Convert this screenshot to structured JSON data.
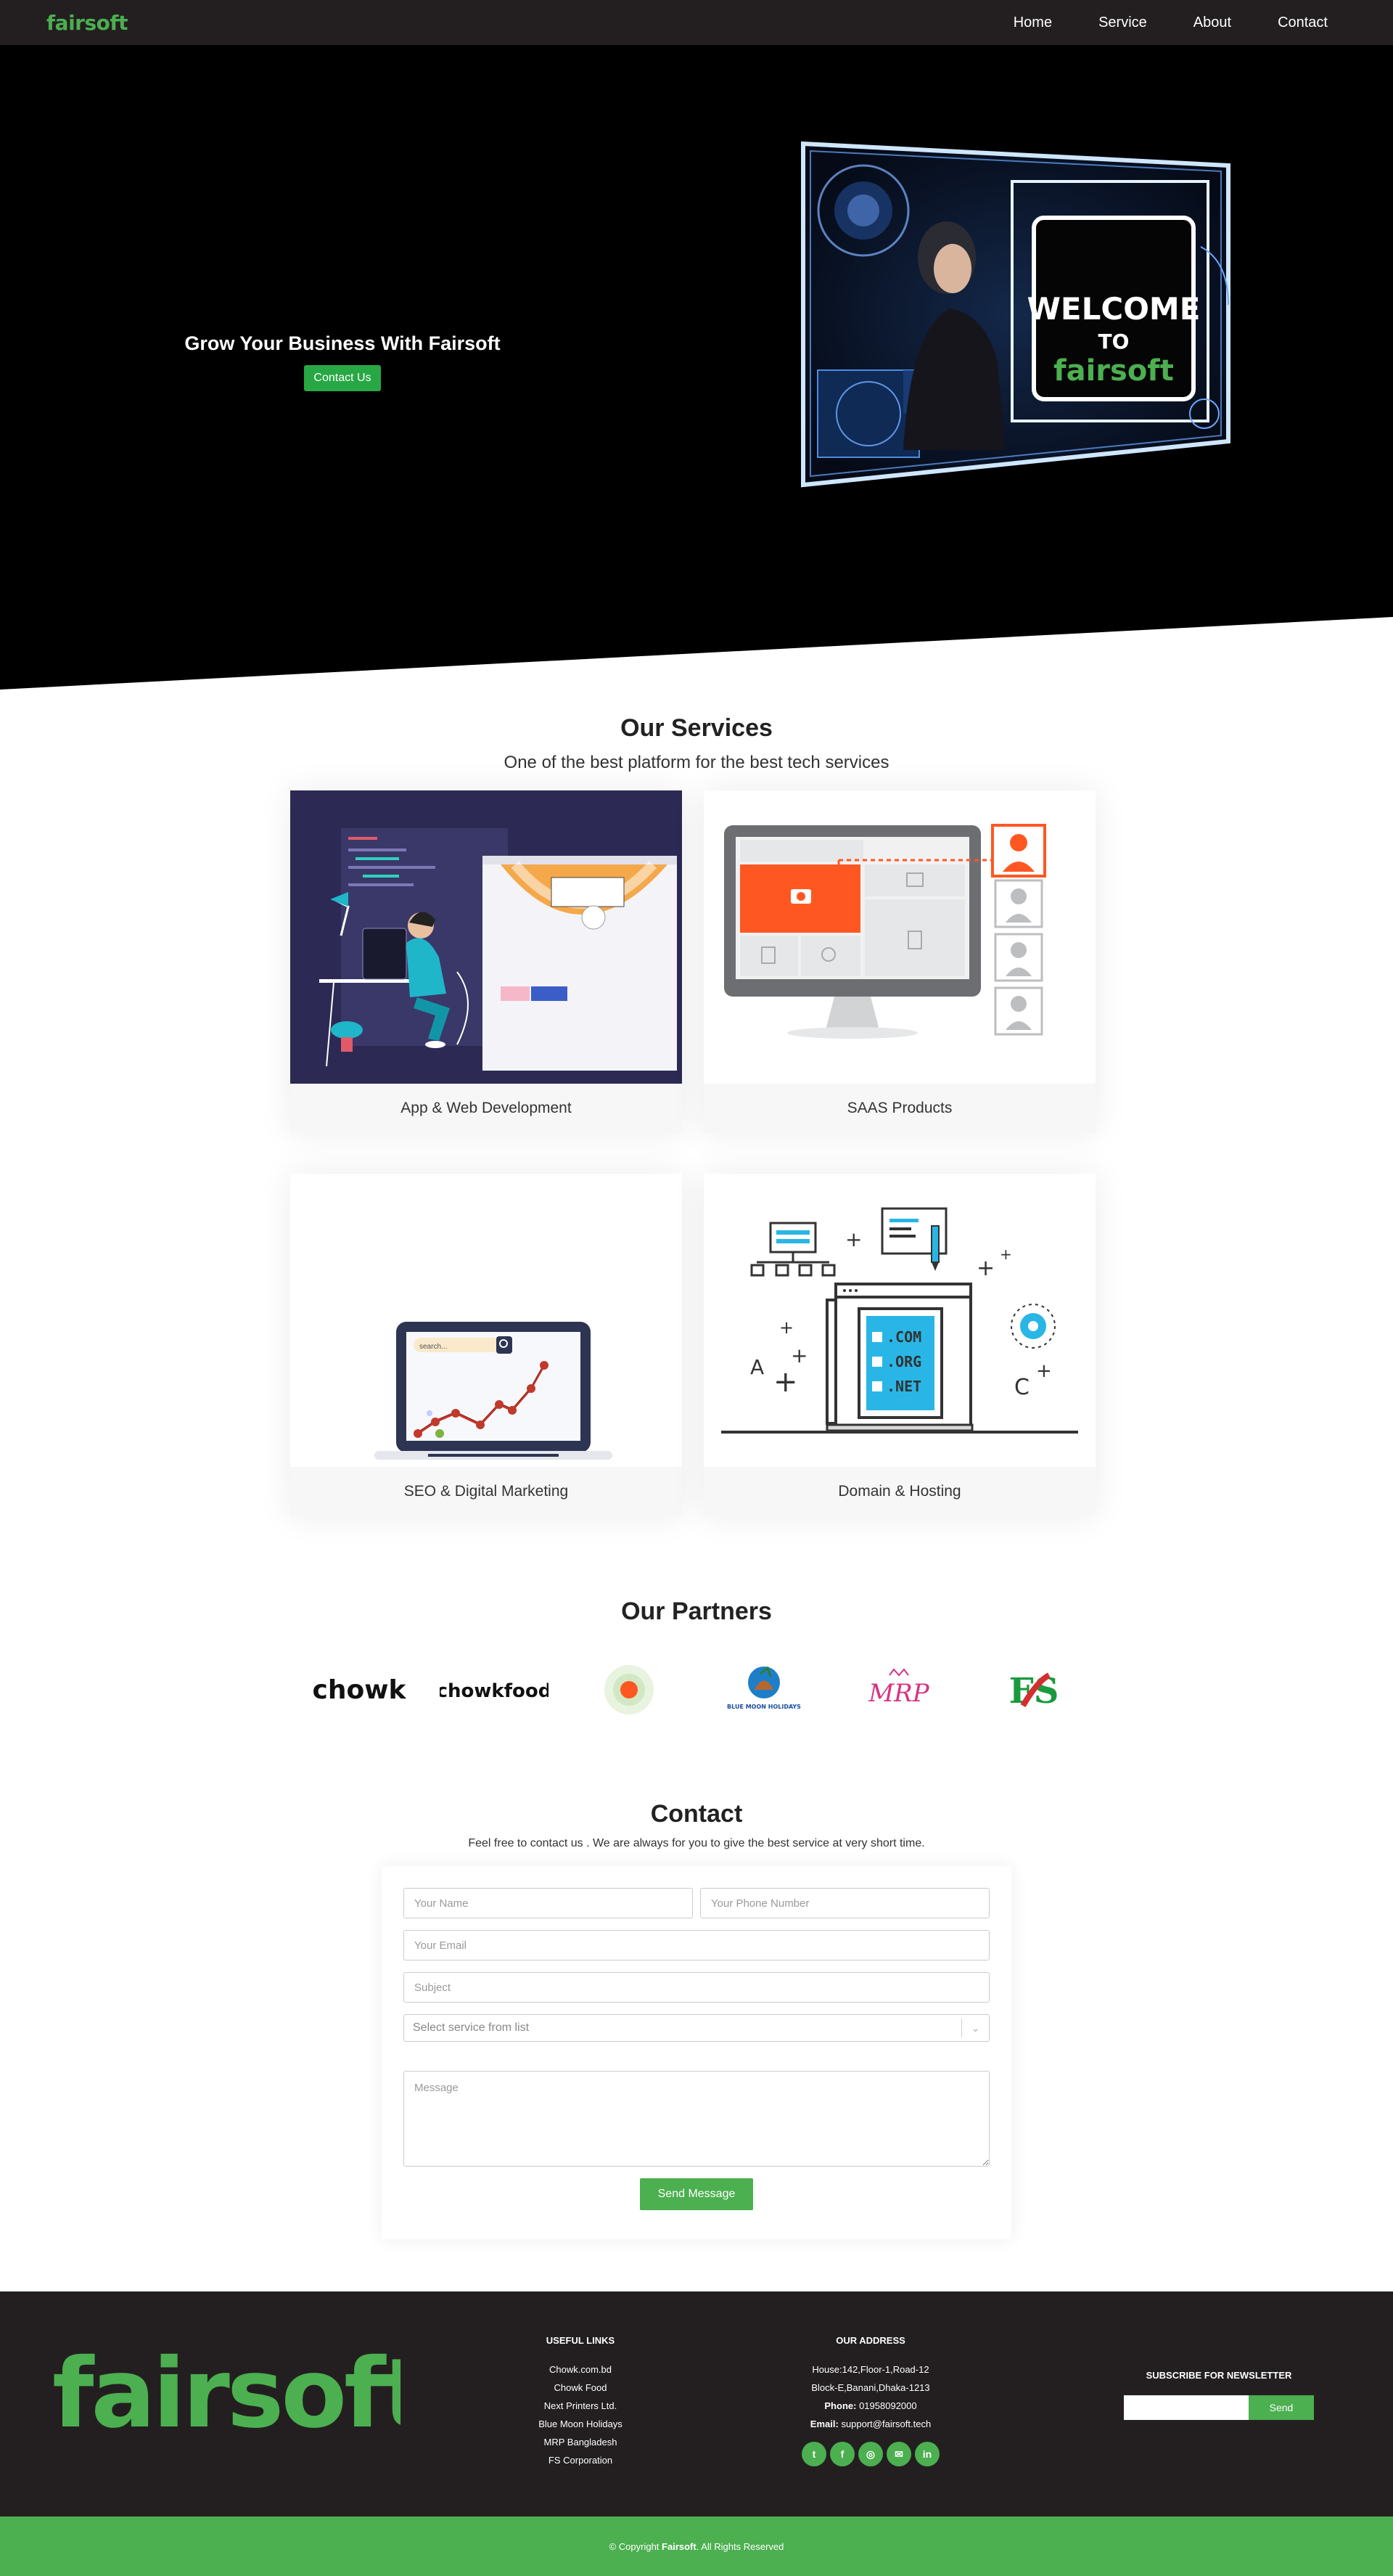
{
  "nav": {
    "brand": "fairsoft",
    "links": [
      "Home",
      "Service",
      "About",
      "Contact"
    ]
  },
  "hero": {
    "title": "Grow Your Business With Fairsoft",
    "cta": "Contact Us",
    "screen_text": [
      "WELCOME",
      "TO",
      "fairsoft"
    ]
  },
  "services": {
    "title": "Our Services",
    "subtitle": "One of the best platform for the best tech services",
    "items": [
      {
        "label": "App & Web Development",
        "icon": "developer-illustration"
      },
      {
        "label": "SAAS Products",
        "icon": "saas-monitor-illustration"
      },
      {
        "label": "SEO & Digital Marketing",
        "icon": "seo-laptop-illustration",
        "search_placeholder": "search..."
      },
      {
        "label": "Domain & Hosting",
        "icon": "domain-laptop-illustration",
        "domains": [
          ".COM",
          ".ORG",
          ".NET"
        ]
      }
    ]
  },
  "partners": {
    "title": "Our Partners",
    "logos": [
      {
        "name": "chowk",
        "text": "chowk"
      },
      {
        "name": "chowkfood",
        "text": "chowkfood"
      },
      {
        "name": "next-printers",
        "text": ""
      },
      {
        "name": "blue-moon-holidays",
        "text": "BLUE MOON HOLIDAYS"
      },
      {
        "name": "mrp",
        "text": "MRP"
      },
      {
        "name": "fs-corporation",
        "text": "FS"
      }
    ]
  },
  "contact": {
    "title": "Contact",
    "subtitle": "Feel free to contact us . We are always for you to give the best service at very short time.",
    "name_placeholder": "Your Name",
    "phone_placeholder": "Your Phone Number",
    "email_placeholder": "Your Email",
    "subject_placeholder": "Subject",
    "select_placeholder": "Select service from list",
    "message_placeholder": "Message",
    "submit": "Send Message"
  },
  "footer": {
    "logo": "fairsoft",
    "links_title": "USEFUL LINKS",
    "links": [
      "Chowk.com.bd",
      "Chowk Food",
      "Next Printers Ltd.",
      "Blue Moon Holidays",
      "MRP Bangladesh",
      "FS Corporation"
    ],
    "address_title": "OUR ADDRESS",
    "address_line1": "House:142,Floor-1,Road-12",
    "address_line2": "Block-E,Banani,Dhaka-1213",
    "phone_label": "Phone:",
    "phone": "01958092000",
    "email_label": "Email:",
    "email": "support@fairsoft.tech",
    "socials": [
      {
        "name": "twitter-icon",
        "glyph": "t"
      },
      {
        "name": "facebook-icon",
        "glyph": "f"
      },
      {
        "name": "instagram-icon",
        "glyph": "◎"
      },
      {
        "name": "email-icon",
        "glyph": "✉"
      },
      {
        "name": "linkedin-icon",
        "glyph": "in"
      }
    ],
    "newsletter_title": "SUBSCRIBE FOR NEWSLETTER",
    "newsletter_button": "Send"
  },
  "copyright": {
    "prefix": "© Copyright",
    "brand": "Fairsoft",
    "suffix": ". All Rights Reserved"
  },
  "colors": {
    "brand_green": "#4caf50",
    "dark": "#231f20",
    "accent_orange": "#ff5722",
    "accent_blue": "#29b6e6"
  }
}
